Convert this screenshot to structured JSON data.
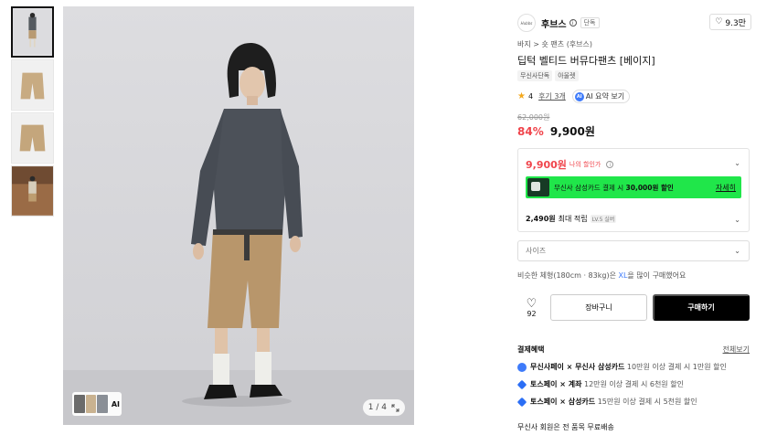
{
  "brand": {
    "logo_text": "Hubbs",
    "name": "후브스",
    "exclusive_tag": "단독",
    "likes": "9.3만"
  },
  "breadcrumb": {
    "category": "바지",
    "separator": ">",
    "sub": "숏 팬츠 (후브스)"
  },
  "product": {
    "title": "딥턱 벨티드 버뮤다팬츠 [베이지]",
    "chips": [
      "무신사단독",
      "아울렛"
    ]
  },
  "rating": {
    "score": "4",
    "review_label": "후기 3개",
    "ai_badge": "AI",
    "ai_summary_label": "AI 요약 보기"
  },
  "price": {
    "original": "62,000원",
    "discount": "84%",
    "sale": "9,900원"
  },
  "price_box": {
    "my_price": "9,900원",
    "my_price_label": "나의 할인가",
    "promo_text_pre": "무신사 삼성카드 결제 시 ",
    "promo_amount": "30,000원 할인",
    "promo_link": "자세히",
    "points_amount": "2,490원",
    "points_label": "최대 적립",
    "points_level": "LV.5 실버"
  },
  "size": {
    "placeholder": "사이즈",
    "rec_pre": "비슷한 체형(180cm · 83kg)은 ",
    "rec_size": "XL",
    "rec_post": "을 많이 구매했어요"
  },
  "actions": {
    "wish_count": "92",
    "cart_label": "장바구니",
    "buy_label": "구매하기"
  },
  "benefits": {
    "title": "결제혜택",
    "more": "전체보기",
    "items": [
      {
        "bold": "무신사페이 × 무신사 삼성카드",
        "text": " 10만원 이상 결제 시 1만원 할인"
      },
      {
        "bold": "토스페이 × 계좌",
        "text": " 12만원 이상 결제 시 6천원 할인"
      },
      {
        "bold": "토스페이 × 삼성카드",
        "text": " 15만원 이상 결제 시 5천원 할인"
      }
    ]
  },
  "shipping": "무신사 회원은 전 품목 무료배송",
  "gallery": {
    "ai_label": "AI",
    "page": "1 / 4"
  },
  "colors": {
    "discount_red": "#f0454c",
    "promo_green": "#20e64a",
    "link_blue": "#3e7bfa",
    "buy_black": "#000000"
  }
}
